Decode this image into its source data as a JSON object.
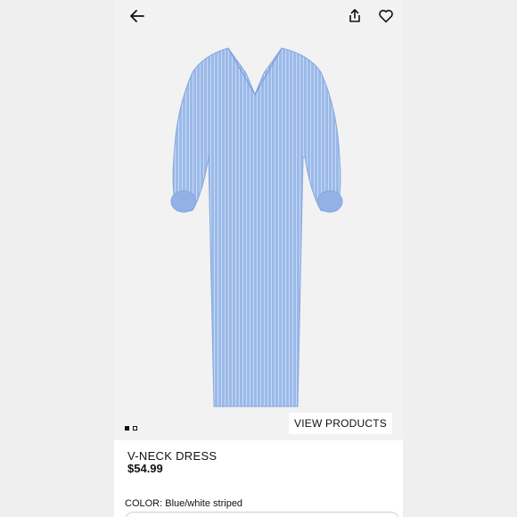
{
  "header": {
    "back_icon": "back-arrow-icon",
    "share_icon": "share-icon",
    "favorite_icon": "heart-icon"
  },
  "gallery": {
    "image_alt_color": "#9bb9e8",
    "pages": 2,
    "active_page": 1,
    "view_products_label": "VIEW PRODUCTS"
  },
  "product": {
    "title": "V-NECK DRESS",
    "price": "$54.99",
    "color_label": "COLOR: Blue/white striped"
  }
}
